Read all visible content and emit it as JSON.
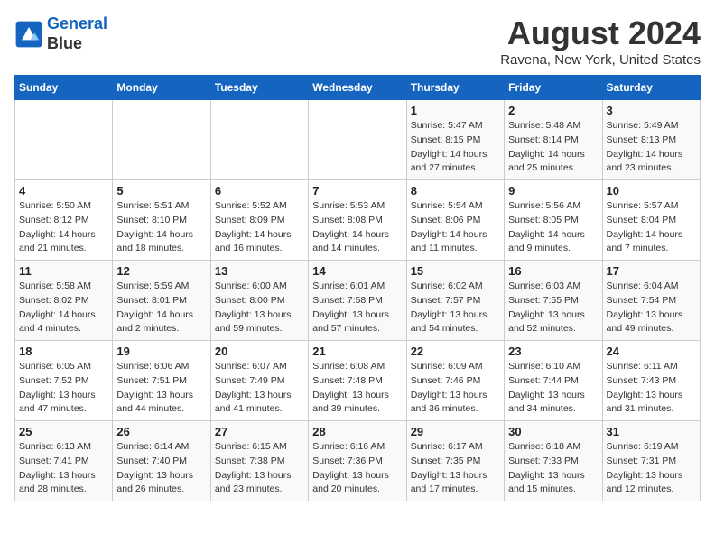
{
  "header": {
    "logo_line1": "General",
    "logo_line2": "Blue",
    "month_year": "August 2024",
    "location": "Ravena, New York, United States"
  },
  "weekdays": [
    "Sunday",
    "Monday",
    "Tuesday",
    "Wednesday",
    "Thursday",
    "Friday",
    "Saturday"
  ],
  "weeks": [
    [
      {
        "day": "",
        "sunrise": "",
        "sunset": "",
        "daylight": ""
      },
      {
        "day": "",
        "sunrise": "",
        "sunset": "",
        "daylight": ""
      },
      {
        "day": "",
        "sunrise": "",
        "sunset": "",
        "daylight": ""
      },
      {
        "day": "",
        "sunrise": "",
        "sunset": "",
        "daylight": ""
      },
      {
        "day": "1",
        "sunrise": "5:47 AM",
        "sunset": "8:15 PM",
        "daylight": "14 hours and 27 minutes."
      },
      {
        "day": "2",
        "sunrise": "5:48 AM",
        "sunset": "8:14 PM",
        "daylight": "14 hours and 25 minutes."
      },
      {
        "day": "3",
        "sunrise": "5:49 AM",
        "sunset": "8:13 PM",
        "daylight": "14 hours and 23 minutes."
      }
    ],
    [
      {
        "day": "4",
        "sunrise": "5:50 AM",
        "sunset": "8:12 PM",
        "daylight": "14 hours and 21 minutes."
      },
      {
        "day": "5",
        "sunrise": "5:51 AM",
        "sunset": "8:10 PM",
        "daylight": "14 hours and 18 minutes."
      },
      {
        "day": "6",
        "sunrise": "5:52 AM",
        "sunset": "8:09 PM",
        "daylight": "14 hours and 16 minutes."
      },
      {
        "day": "7",
        "sunrise": "5:53 AM",
        "sunset": "8:08 PM",
        "daylight": "14 hours and 14 minutes."
      },
      {
        "day": "8",
        "sunrise": "5:54 AM",
        "sunset": "8:06 PM",
        "daylight": "14 hours and 11 minutes."
      },
      {
        "day": "9",
        "sunrise": "5:56 AM",
        "sunset": "8:05 PM",
        "daylight": "14 hours and 9 minutes."
      },
      {
        "day": "10",
        "sunrise": "5:57 AM",
        "sunset": "8:04 PM",
        "daylight": "14 hours and 7 minutes."
      }
    ],
    [
      {
        "day": "11",
        "sunrise": "5:58 AM",
        "sunset": "8:02 PM",
        "daylight": "14 hours and 4 minutes."
      },
      {
        "day": "12",
        "sunrise": "5:59 AM",
        "sunset": "8:01 PM",
        "daylight": "14 hours and 2 minutes."
      },
      {
        "day": "13",
        "sunrise": "6:00 AM",
        "sunset": "8:00 PM",
        "daylight": "13 hours and 59 minutes."
      },
      {
        "day": "14",
        "sunrise": "6:01 AM",
        "sunset": "7:58 PM",
        "daylight": "13 hours and 57 minutes."
      },
      {
        "day": "15",
        "sunrise": "6:02 AM",
        "sunset": "7:57 PM",
        "daylight": "13 hours and 54 minutes."
      },
      {
        "day": "16",
        "sunrise": "6:03 AM",
        "sunset": "7:55 PM",
        "daylight": "13 hours and 52 minutes."
      },
      {
        "day": "17",
        "sunrise": "6:04 AM",
        "sunset": "7:54 PM",
        "daylight": "13 hours and 49 minutes."
      }
    ],
    [
      {
        "day": "18",
        "sunrise": "6:05 AM",
        "sunset": "7:52 PM",
        "daylight": "13 hours and 47 minutes."
      },
      {
        "day": "19",
        "sunrise": "6:06 AM",
        "sunset": "7:51 PM",
        "daylight": "13 hours and 44 minutes."
      },
      {
        "day": "20",
        "sunrise": "6:07 AM",
        "sunset": "7:49 PM",
        "daylight": "13 hours and 41 minutes."
      },
      {
        "day": "21",
        "sunrise": "6:08 AM",
        "sunset": "7:48 PM",
        "daylight": "13 hours and 39 minutes."
      },
      {
        "day": "22",
        "sunrise": "6:09 AM",
        "sunset": "7:46 PM",
        "daylight": "13 hours and 36 minutes."
      },
      {
        "day": "23",
        "sunrise": "6:10 AM",
        "sunset": "7:44 PM",
        "daylight": "13 hours and 34 minutes."
      },
      {
        "day": "24",
        "sunrise": "6:11 AM",
        "sunset": "7:43 PM",
        "daylight": "13 hours and 31 minutes."
      }
    ],
    [
      {
        "day": "25",
        "sunrise": "6:13 AM",
        "sunset": "7:41 PM",
        "daylight": "13 hours and 28 minutes."
      },
      {
        "day": "26",
        "sunrise": "6:14 AM",
        "sunset": "7:40 PM",
        "daylight": "13 hours and 26 minutes."
      },
      {
        "day": "27",
        "sunrise": "6:15 AM",
        "sunset": "7:38 PM",
        "daylight": "13 hours and 23 minutes."
      },
      {
        "day": "28",
        "sunrise": "6:16 AM",
        "sunset": "7:36 PM",
        "daylight": "13 hours and 20 minutes."
      },
      {
        "day": "29",
        "sunrise": "6:17 AM",
        "sunset": "7:35 PM",
        "daylight": "13 hours and 17 minutes."
      },
      {
        "day": "30",
        "sunrise": "6:18 AM",
        "sunset": "7:33 PM",
        "daylight": "13 hours and 15 minutes."
      },
      {
        "day": "31",
        "sunrise": "6:19 AM",
        "sunset": "7:31 PM",
        "daylight": "13 hours and 12 minutes."
      }
    ]
  ]
}
